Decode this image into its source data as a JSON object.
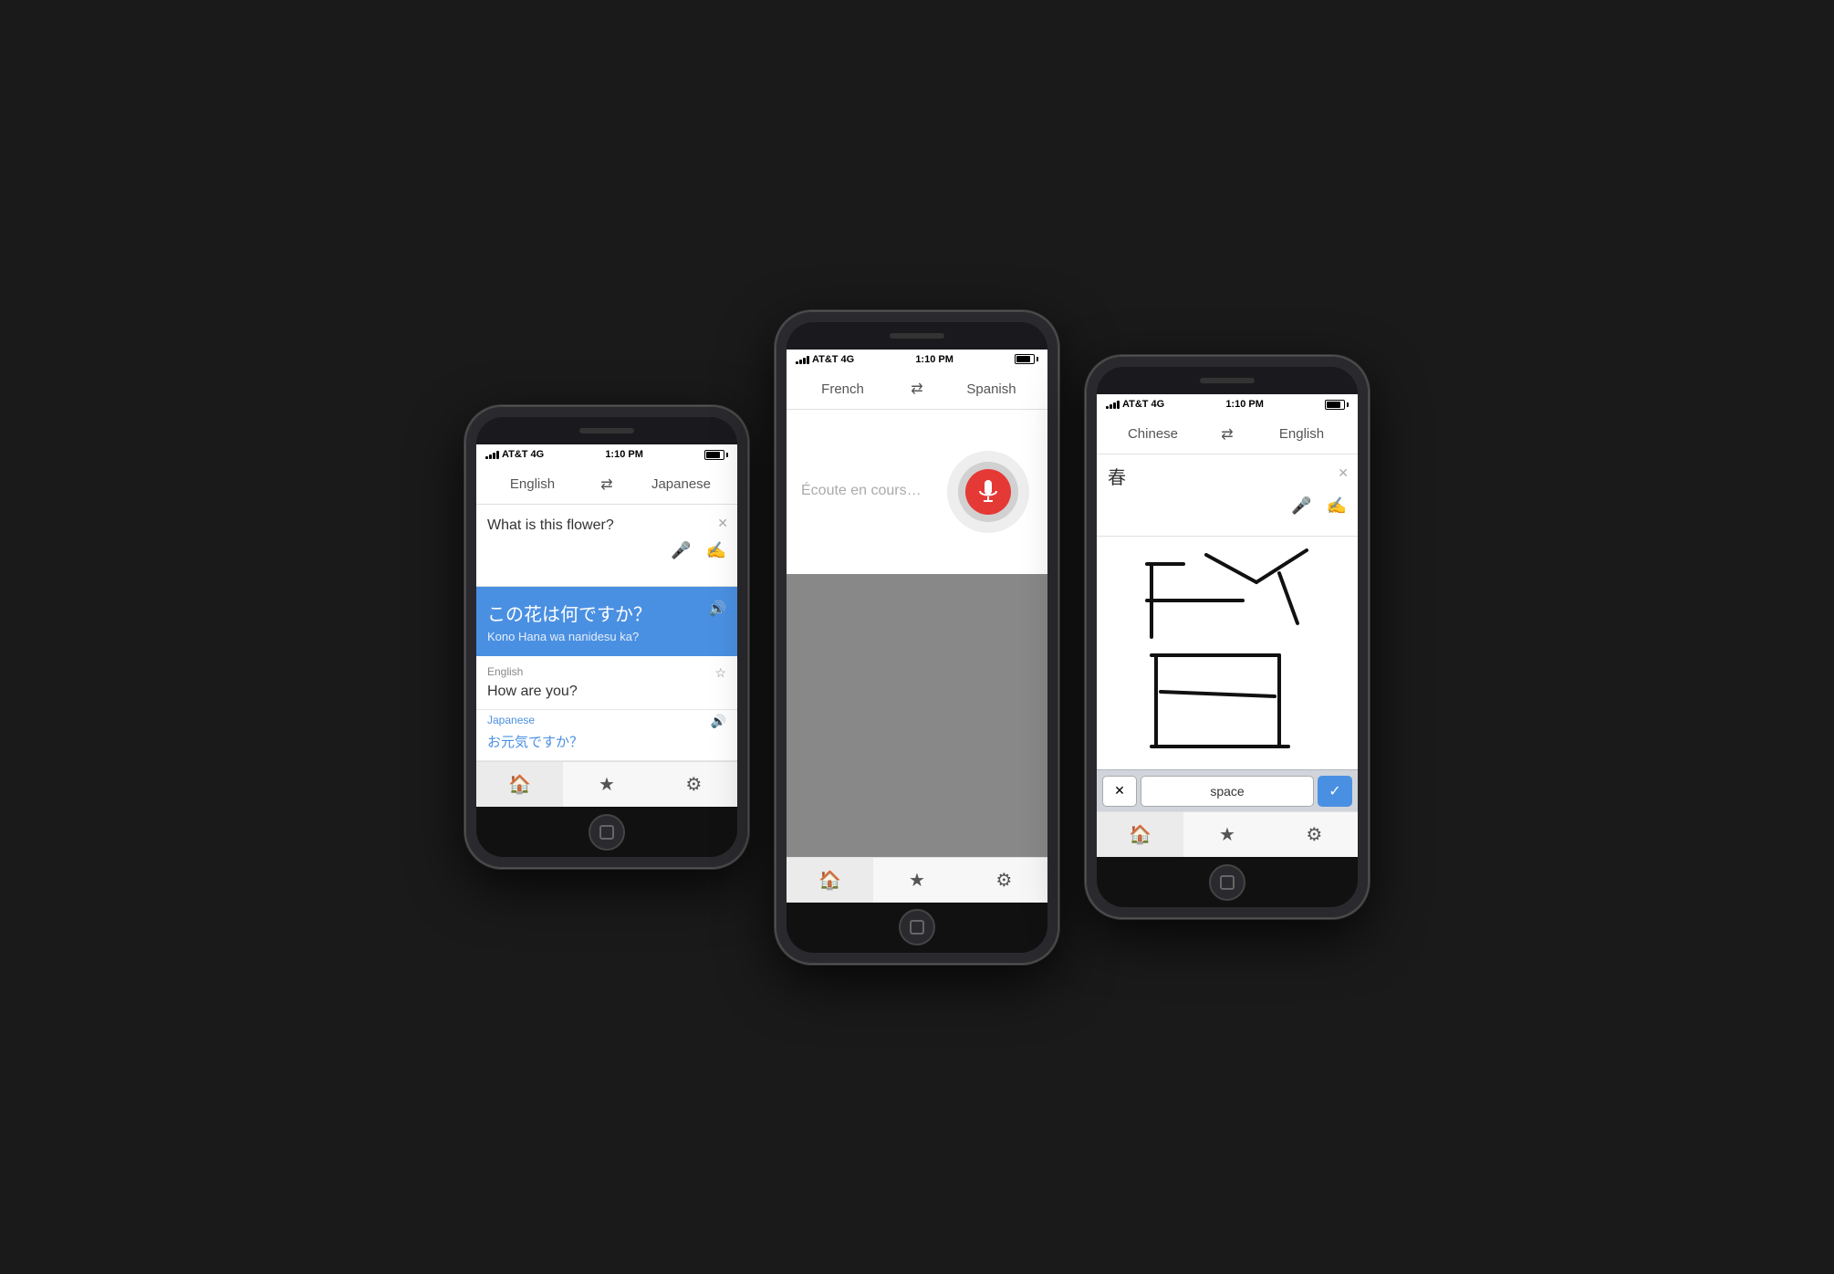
{
  "phone1": {
    "status": {
      "carrier": "AT&T",
      "network": "4G",
      "time": "1:10 PM"
    },
    "lang_from": "English",
    "lang_to": "Japanese",
    "input_text": "What is this flower?",
    "translation_main": "この花は何ですか？",
    "translation_romanized": "Kono Hana wa nanidesu ka?",
    "history": [
      {
        "lang_source": "English",
        "source_text": "How are you?",
        "lang_target": "Japanese",
        "target_text": "お元気ですか？"
      }
    ],
    "nav": [
      "🏠",
      "★",
      "⚙"
    ]
  },
  "phone2": {
    "status": {
      "carrier": "AT&T",
      "network": "4G",
      "time": "1:10 PM"
    },
    "lang_from": "French",
    "lang_to": "Spanish",
    "input_placeholder": "Écoute en cours…",
    "nav": [
      "🏠",
      "★",
      "⚙"
    ]
  },
  "phone3": {
    "status": {
      "carrier": "AT&T",
      "network": "4G",
      "time": "1:10 PM"
    },
    "lang_from": "Chinese",
    "lang_to": "English",
    "input_text": "春",
    "keyboard": {
      "backspace": "✕",
      "space": "space",
      "confirm": "✓"
    },
    "nav": [
      "🏠",
      "★",
      "⚙"
    ]
  }
}
